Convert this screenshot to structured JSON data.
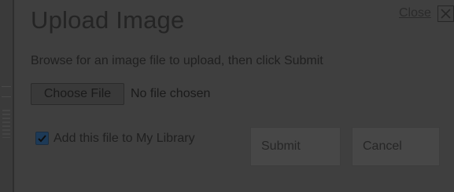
{
  "dialog": {
    "title": "Upload Image",
    "close_label": "Close",
    "close_icon": "close-icon",
    "instructions": "Browse for an image file to upload, then click Submit"
  },
  "file_input": {
    "button_label": "Choose File",
    "status_text": "No file chosen"
  },
  "library_option": {
    "label": "Add this file to My Library",
    "checked": true
  },
  "actions": {
    "submit_label": "Submit",
    "cancel_label": "Cancel"
  },
  "colors": {
    "overlay": "#2e2e2e",
    "dialog_bg": "#3f3f3f",
    "checkbox_accent": "#1d3a57"
  }
}
